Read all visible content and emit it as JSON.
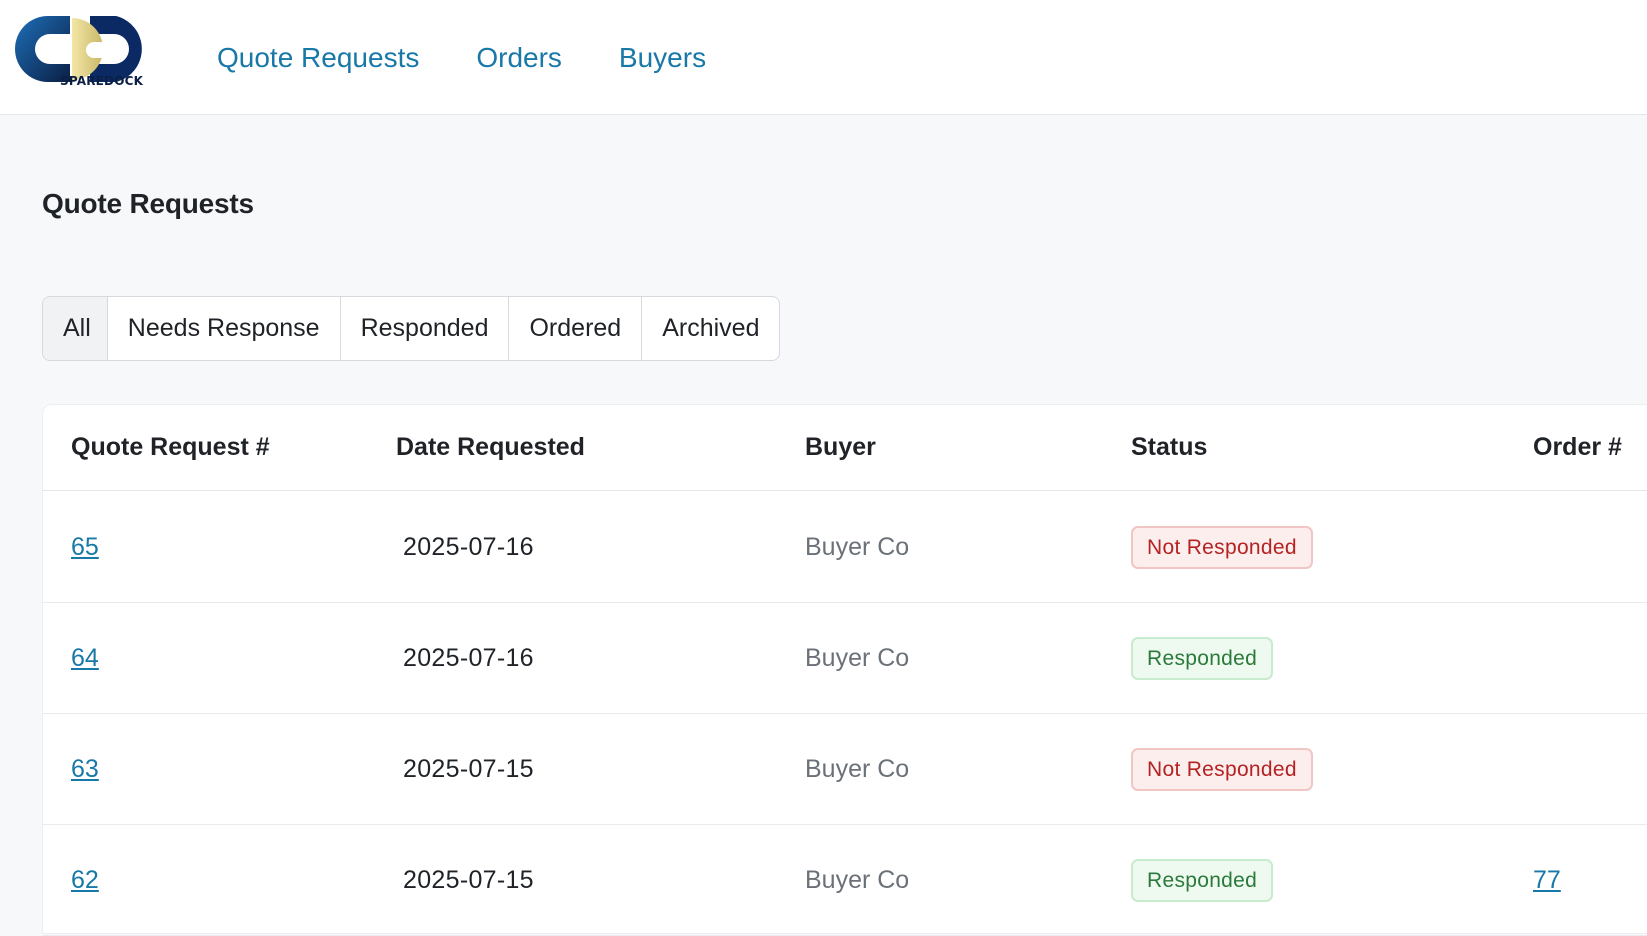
{
  "brand": {
    "logo_text": "SPAREDOCK",
    "primary_color": "#0b2a63",
    "accent_color": "#e8d98a",
    "link_color": "#1878a8"
  },
  "nav": [
    {
      "label": "Quote Requests"
    },
    {
      "label": "Orders"
    },
    {
      "label": "Buyers"
    }
  ],
  "page": {
    "title": "Quote Requests"
  },
  "filters": {
    "tabs": [
      {
        "label": "All",
        "active": true
      },
      {
        "label": "Needs Response",
        "active": false
      },
      {
        "label": "Responded",
        "active": false
      },
      {
        "label": "Ordered",
        "active": false
      },
      {
        "label": "Archived",
        "active": false
      }
    ]
  },
  "table": {
    "headers": [
      "Quote Request #",
      "Date Requested",
      "Buyer",
      "Status",
      "Order #"
    ],
    "rows": [
      {
        "id": "65",
        "date": "2025-07-16",
        "buyer": "Buyer Co",
        "status": "Not Responded",
        "status_kind": "bad",
        "order": ""
      },
      {
        "id": "64",
        "date": "2025-07-16",
        "buyer": "Buyer Co",
        "status": "Responded",
        "status_kind": "good",
        "order": ""
      },
      {
        "id": "63",
        "date": "2025-07-15",
        "buyer": "Buyer Co",
        "status": "Not Responded",
        "status_kind": "bad",
        "order": ""
      },
      {
        "id": "62",
        "date": "2025-07-15",
        "buyer": "Buyer Co",
        "status": "Responded",
        "status_kind": "good",
        "order": "77"
      }
    ]
  }
}
